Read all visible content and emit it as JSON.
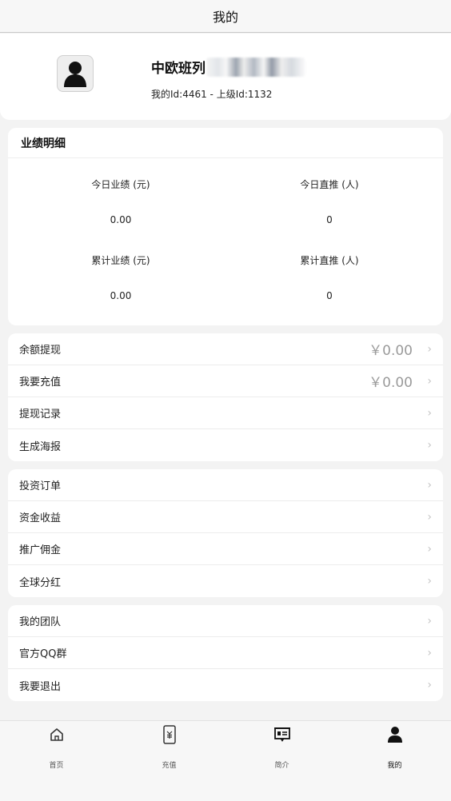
{
  "header": {
    "title": "我的"
  },
  "profile": {
    "name": "中欧班列",
    "ids": "我的Id:4461 - 上级Id:1132"
  },
  "performance": {
    "title": "业绩明细",
    "stats": [
      {
        "label": "今日业绩 (元)",
        "value": "0.00"
      },
      {
        "label": "今日直推 (人)",
        "value": "0"
      },
      {
        "label": "累计业绩 (元)",
        "value": "0.00"
      },
      {
        "label": "累计直推 (人)",
        "value": "0"
      }
    ]
  },
  "group1": [
    {
      "label": "余额提现",
      "amount": "￥0.00"
    },
    {
      "label": "我要充值",
      "amount": "￥0.00"
    },
    {
      "label": "提现记录"
    },
    {
      "label": "生成海报"
    }
  ],
  "group2": [
    {
      "label": "投资订单"
    },
    {
      "label": "资金收益"
    },
    {
      "label": "推广佣金"
    },
    {
      "label": "全球分红"
    }
  ],
  "group3": [
    {
      "label": "我的团队"
    },
    {
      "label": "官方QQ群"
    },
    {
      "label": "我要退出"
    }
  ],
  "tabbar": [
    {
      "label": "首页",
      "icon": "home-icon"
    },
    {
      "label": "充值",
      "icon": "recharge-icon"
    },
    {
      "label": "简介",
      "icon": "intro-icon"
    },
    {
      "label": "我的",
      "icon": "user-icon"
    }
  ],
  "colors": {
    "active_tab": "#111111",
    "inactive_tab": "#555555",
    "amount": "#9a9a9a"
  }
}
